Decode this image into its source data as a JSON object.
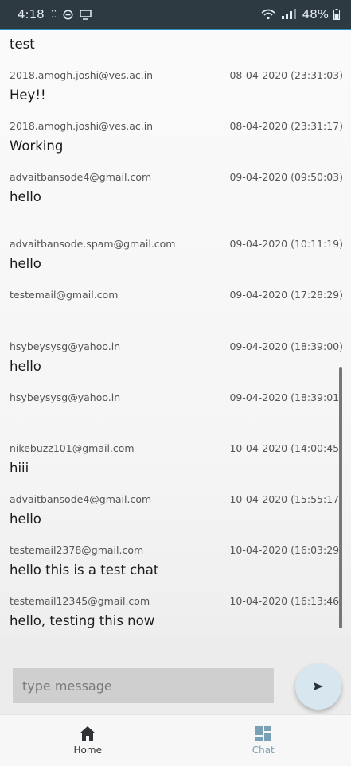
{
  "status_bar": {
    "time": "4:18",
    "left_glyphs": "⁚⁚",
    "battery": "48%"
  },
  "messages": [
    {
      "sender": "",
      "time": "",
      "text": "test"
    },
    {
      "sender": "2018.amogh.joshi@ves.ac.in",
      "time": "08-04-2020 (23:31:03)",
      "text": "Hey!!"
    },
    {
      "sender": "2018.amogh.joshi@ves.ac.in",
      "time": "08-04-2020 (23:31:17)",
      "text": "Working"
    },
    {
      "sender": "advaitbansode4@gmail.com",
      "time": "09-04-2020 (09:50:03)",
      "text": "hello"
    },
    {
      "sender": "advaitbansode.spam@gmail.com",
      "time": "09-04-2020 (10:11:19)",
      "text": "hello"
    },
    {
      "sender": "testemail@gmail.com",
      "time": "09-04-2020 (17:28:29)",
      "text": ""
    },
    {
      "sender": "hsybeysysg@yahoo.in",
      "time": "09-04-2020 (18:39:00)",
      "text": "hello"
    },
    {
      "sender": "hsybeysysg@yahoo.in",
      "time": "09-04-2020 (18:39:01)",
      "text": ""
    },
    {
      "sender": "nikebuzz101@gmail.com",
      "time": "10-04-2020 (14:00:45)",
      "text": "hiii"
    },
    {
      "sender": "advaitbansode4@gmail.com",
      "time": "10-04-2020 (15:55:17)",
      "text": "hello"
    },
    {
      "sender": "testemail2378@gmail.com",
      "time": "10-04-2020 (16:03:29)",
      "text": "hello this is a test chat"
    },
    {
      "sender": "testemail12345@gmail.com",
      "time": "10-04-2020 (16:13:46)",
      "text": "hello, testing this now"
    }
  ],
  "input": {
    "placeholder": "type message",
    "value": ""
  },
  "send_icon": "send-arrow-icon",
  "nav": {
    "home_label": "Home",
    "chat_label": "Chat",
    "active": "Chat"
  },
  "colors": {
    "status_bar": "#2d3a42",
    "accent": "#2f8fc9",
    "nav_active": "#7aa0b5",
    "send_button": "#d7e6ef"
  }
}
